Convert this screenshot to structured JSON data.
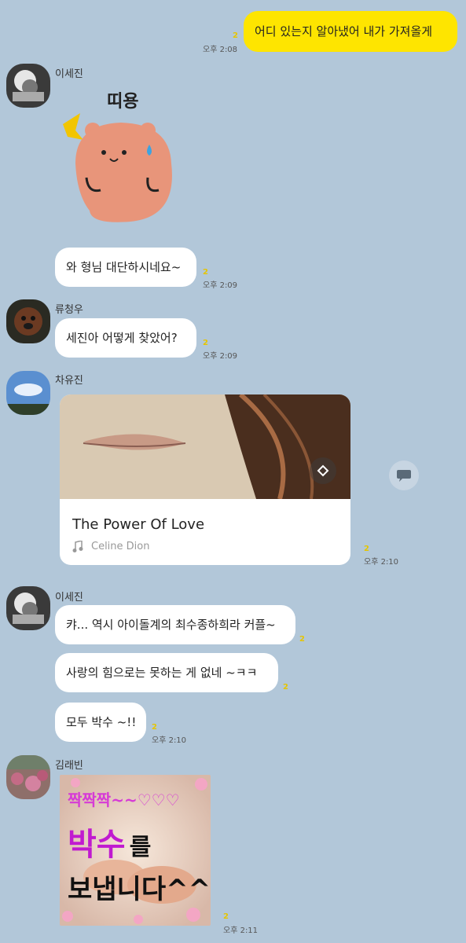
{
  "messages": {
    "m1": {
      "text": "어디 있는지 알아냈어 내가 가져올게",
      "unread": "2",
      "time": "오후 2:08"
    },
    "sejin_name": "이세진",
    "sticker": {
      "caption": "띠용"
    },
    "m2": {
      "text": "와 형님 대단하시네요~",
      "unread": "2",
      "time": "오후 2:09"
    },
    "ryu_name": "류청우",
    "m3": {
      "text": "세진아 어떻게 찾았어?",
      "unread": "2",
      "time": "오후 2:09"
    },
    "cha_name": "차유진",
    "music": {
      "title": "The Power Of Love",
      "artist": "Celine Dion",
      "unread": "2",
      "time": "오후 2:10"
    },
    "sejin_name2": "이세진",
    "m4": {
      "text": "캬... 역시 아이돌계의 최수종하희라 커플~",
      "unread": "2"
    },
    "m5": {
      "text": "사랑의 힘으로는 못하는 게 없네 ~ㅋㅋ",
      "unread": "2"
    },
    "m6": {
      "text": "모두 박수 ~!!",
      "unread": "2",
      "time": "오후 2:10"
    },
    "kim_name": "김래빈",
    "clap_image": {
      "line1": "짝짝짝~~♡♡♡",
      "line2a": "박수",
      "line2b": "를",
      "line3": "보냅니다^^",
      "unread": "2",
      "time": "오후 2:11"
    }
  },
  "colors": {
    "background": "#b2c7d9",
    "my_bubble": "#fee500",
    "other_bubble": "#ffffff",
    "unread": "#e5c500"
  },
  "icons": [
    "share-icon",
    "music-note-icon",
    "logo-icon"
  ]
}
